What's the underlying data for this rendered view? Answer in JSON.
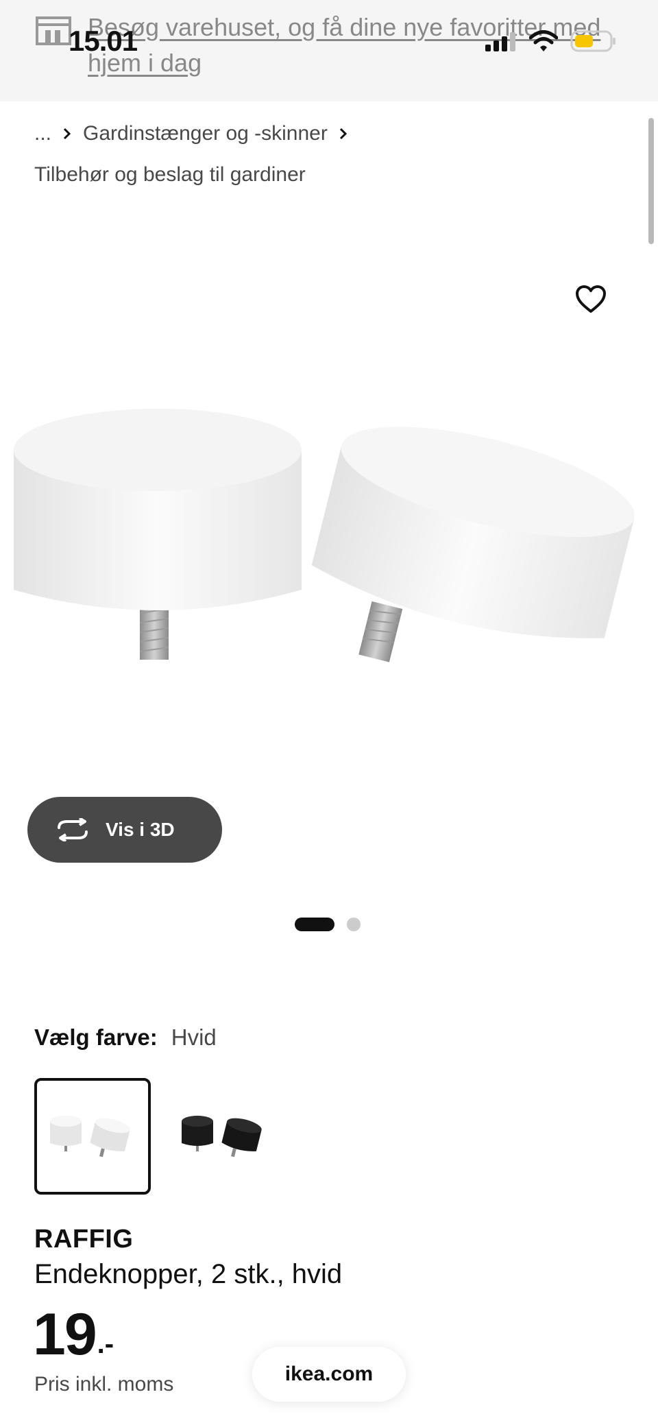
{
  "status_bar": {
    "time": "15.01",
    "signal_icon": "cellular-signal-icon",
    "wifi_icon": "wifi-icon",
    "battery_icon": "battery-icon",
    "battery_color": "#f7c600"
  },
  "banner": {
    "icon": "store-icon",
    "text": "Besøg varehuset, og få dine nye favoritter med hjem i dag"
  },
  "breadcrumb": {
    "ellipsis": "...",
    "items": [
      "Gardinstænger og -skinner",
      "Tilbehør og beslag til gardiner"
    ]
  },
  "gallery": {
    "favourite_icon": "heart-icon",
    "image_alt": "RAFFIG endeknopper, hvid",
    "view_3d_label": "Vis i 3D",
    "view_3d_icon": "rotate-3d-icon",
    "dots_total": 2,
    "dot_active": 1
  },
  "color": {
    "label": "Vælg farve:",
    "selected": "Hvid",
    "options": [
      {
        "name": "Hvid",
        "color": "#f2f2f2",
        "selected": true
      },
      {
        "name": "Sort",
        "color": "#1a1a1a",
        "selected": false
      }
    ]
  },
  "product": {
    "name": "RAFFIG",
    "description": "Endeknopper, 2 stk., hvid",
    "price_integer": "19",
    "price_decimal": ".-",
    "price_note": "Pris inkl. moms"
  },
  "browser": {
    "url": "ikea.com"
  },
  "colors": {
    "banner_bg": "#f5f5f5",
    "dark_button": "#484848",
    "text_primary": "#111111",
    "text_secondary": "#484848"
  }
}
